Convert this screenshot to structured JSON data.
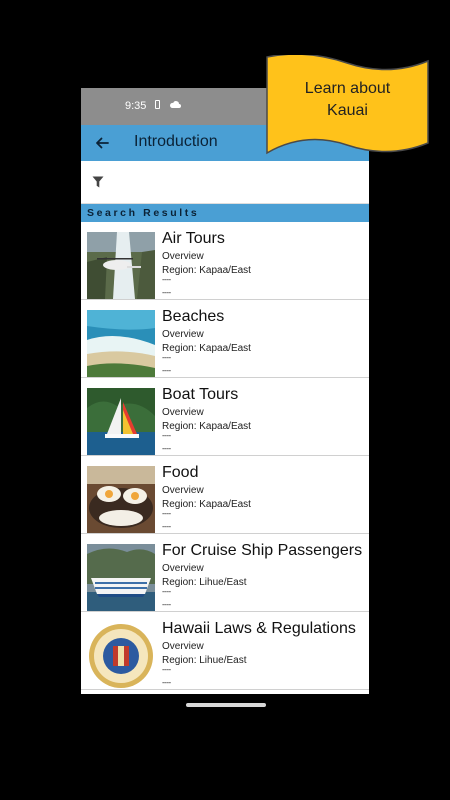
{
  "status_bar": {
    "time": "9:35"
  },
  "app_bar": {
    "title": "Introduction"
  },
  "section_header": "Search Results",
  "banner": {
    "line1": "Learn about",
    "line2": "Kauai",
    "color": "#ffc21a"
  },
  "colors": {
    "accent": "#4a9fd4",
    "status_bar": "#8d8d8d"
  },
  "results": [
    {
      "title": "Air Tours",
      "subtitle": "Overview",
      "region": "Region: Kapaa/East",
      "detail1": "----",
      "detail2": "----",
      "image": "helicopter-waterfall"
    },
    {
      "title": "Beaches",
      "subtitle": "Overview",
      "region": "Region: Kapaa/East",
      "detail1": "----",
      "detail2": "----",
      "image": "beach-shoreline"
    },
    {
      "title": "Boat Tours",
      "subtitle": "Overview",
      "region": "Region: Kapaa/East",
      "detail1": "----",
      "detail2": "----",
      "image": "catamaran-sailboat"
    },
    {
      "title": "Food",
      "subtitle": "Overview",
      "region": "Region: Kapaa/East",
      "detail1": "----",
      "detail2": "----",
      "image": "loco-moco-plate"
    },
    {
      "title": "For Cruise Ship Passengers",
      "subtitle": "Overview",
      "region": "Region: Lihue/East",
      "detail1": "----",
      "detail2": "----",
      "image": "cruise-ship"
    },
    {
      "title": "Hawaii Laws & Regulations",
      "subtitle": "Overview",
      "region": "Region: Lihue/East",
      "detail1": "----",
      "detail2": "----",
      "image": "state-seal"
    }
  ]
}
